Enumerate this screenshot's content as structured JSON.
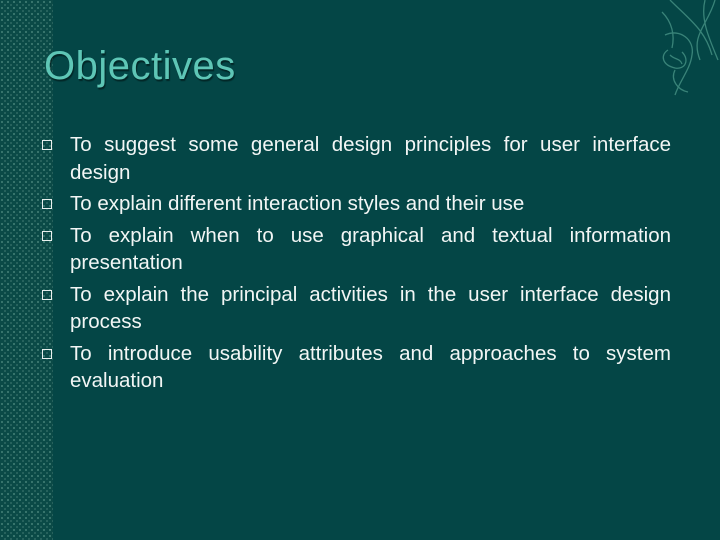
{
  "slide": {
    "title": "Objectives",
    "bullets": [
      "To suggest some general design principles for user interface design",
      "To explain different interaction styles and their use",
      "To explain when to use graphical and textual information presentation",
      "To explain the principal activities in the user interface design process",
      "To introduce usability attributes and approaches to system evaluation"
    ]
  },
  "theme": {
    "background": "#044646",
    "title_color": "#5ec6b6",
    "text_color": "#f2f6f5"
  }
}
